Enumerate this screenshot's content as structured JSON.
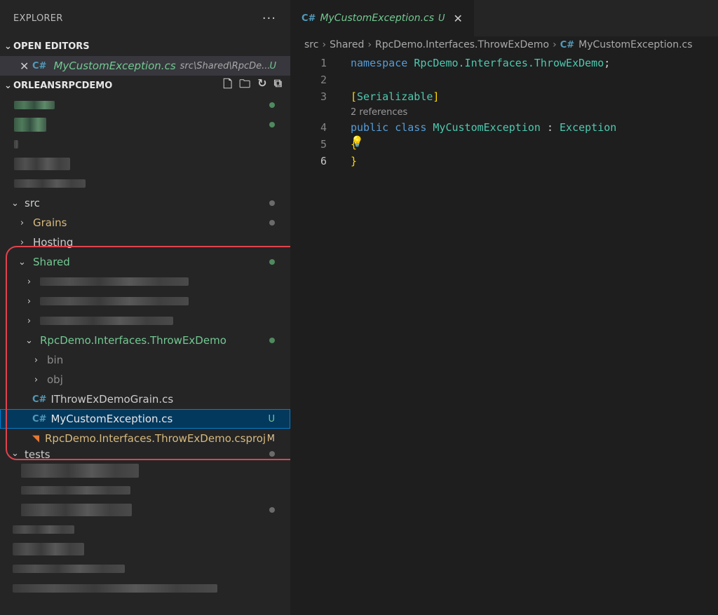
{
  "sidebar": {
    "title": "EXPLORER",
    "more": "···",
    "open_editors": {
      "header": "OPEN EDITORS",
      "item": {
        "close": "✕",
        "name": "MyCustomException.cs",
        "path": "src\\Shared\\RpcDe...",
        "badge": "U"
      }
    },
    "workspace": {
      "header": "ORLEANSRPCDEMO"
    },
    "tree": {
      "src": "src",
      "grains": "Grains",
      "hosting": "Hosting",
      "shared": "Shared",
      "project_folder": "RpcDemo.Interfaces.ThrowExDemo",
      "bin": "bin",
      "obj": "obj",
      "file1": "IThrowExDemoGrain.cs",
      "file2": "MyCustomException.cs",
      "file2_badge": "U",
      "file3": "RpcDemo.Interfaces.ThrowExDemo.csproj",
      "file3_badge": "M",
      "tests": "tests"
    }
  },
  "editor": {
    "tab": {
      "name": "MyCustomException.cs",
      "badge": "U",
      "close": "✕"
    },
    "breadcrumb": [
      "src",
      "Shared",
      "RpcDemo.Interfaces.ThrowExDemo",
      "MyCustomException.cs"
    ],
    "codelens": "2 references",
    "lines": {
      "n1": "1",
      "n2": "2",
      "n3": "3",
      "n4": "4",
      "n5": "5",
      "n6": "6",
      "l1_kw": "namespace",
      "l1_ns": "RpcDemo.Interfaces.ThrowExDemo",
      "l1_end": ";",
      "l3_open": "[",
      "l3_attr": "Serializable",
      "l3_close": "]",
      "l4_kw1": "public",
      "l4_kw2": "class",
      "l4_name": "MyCustomException",
      "l4_colon": ":",
      "l4_base": "Exception",
      "l5_brace": "{",
      "l6_brace": "}"
    }
  },
  "colors": {
    "accent": "#007fd4",
    "untracked": "#73c991",
    "modified": "#e2c08d",
    "highlight": "#e0434b"
  }
}
